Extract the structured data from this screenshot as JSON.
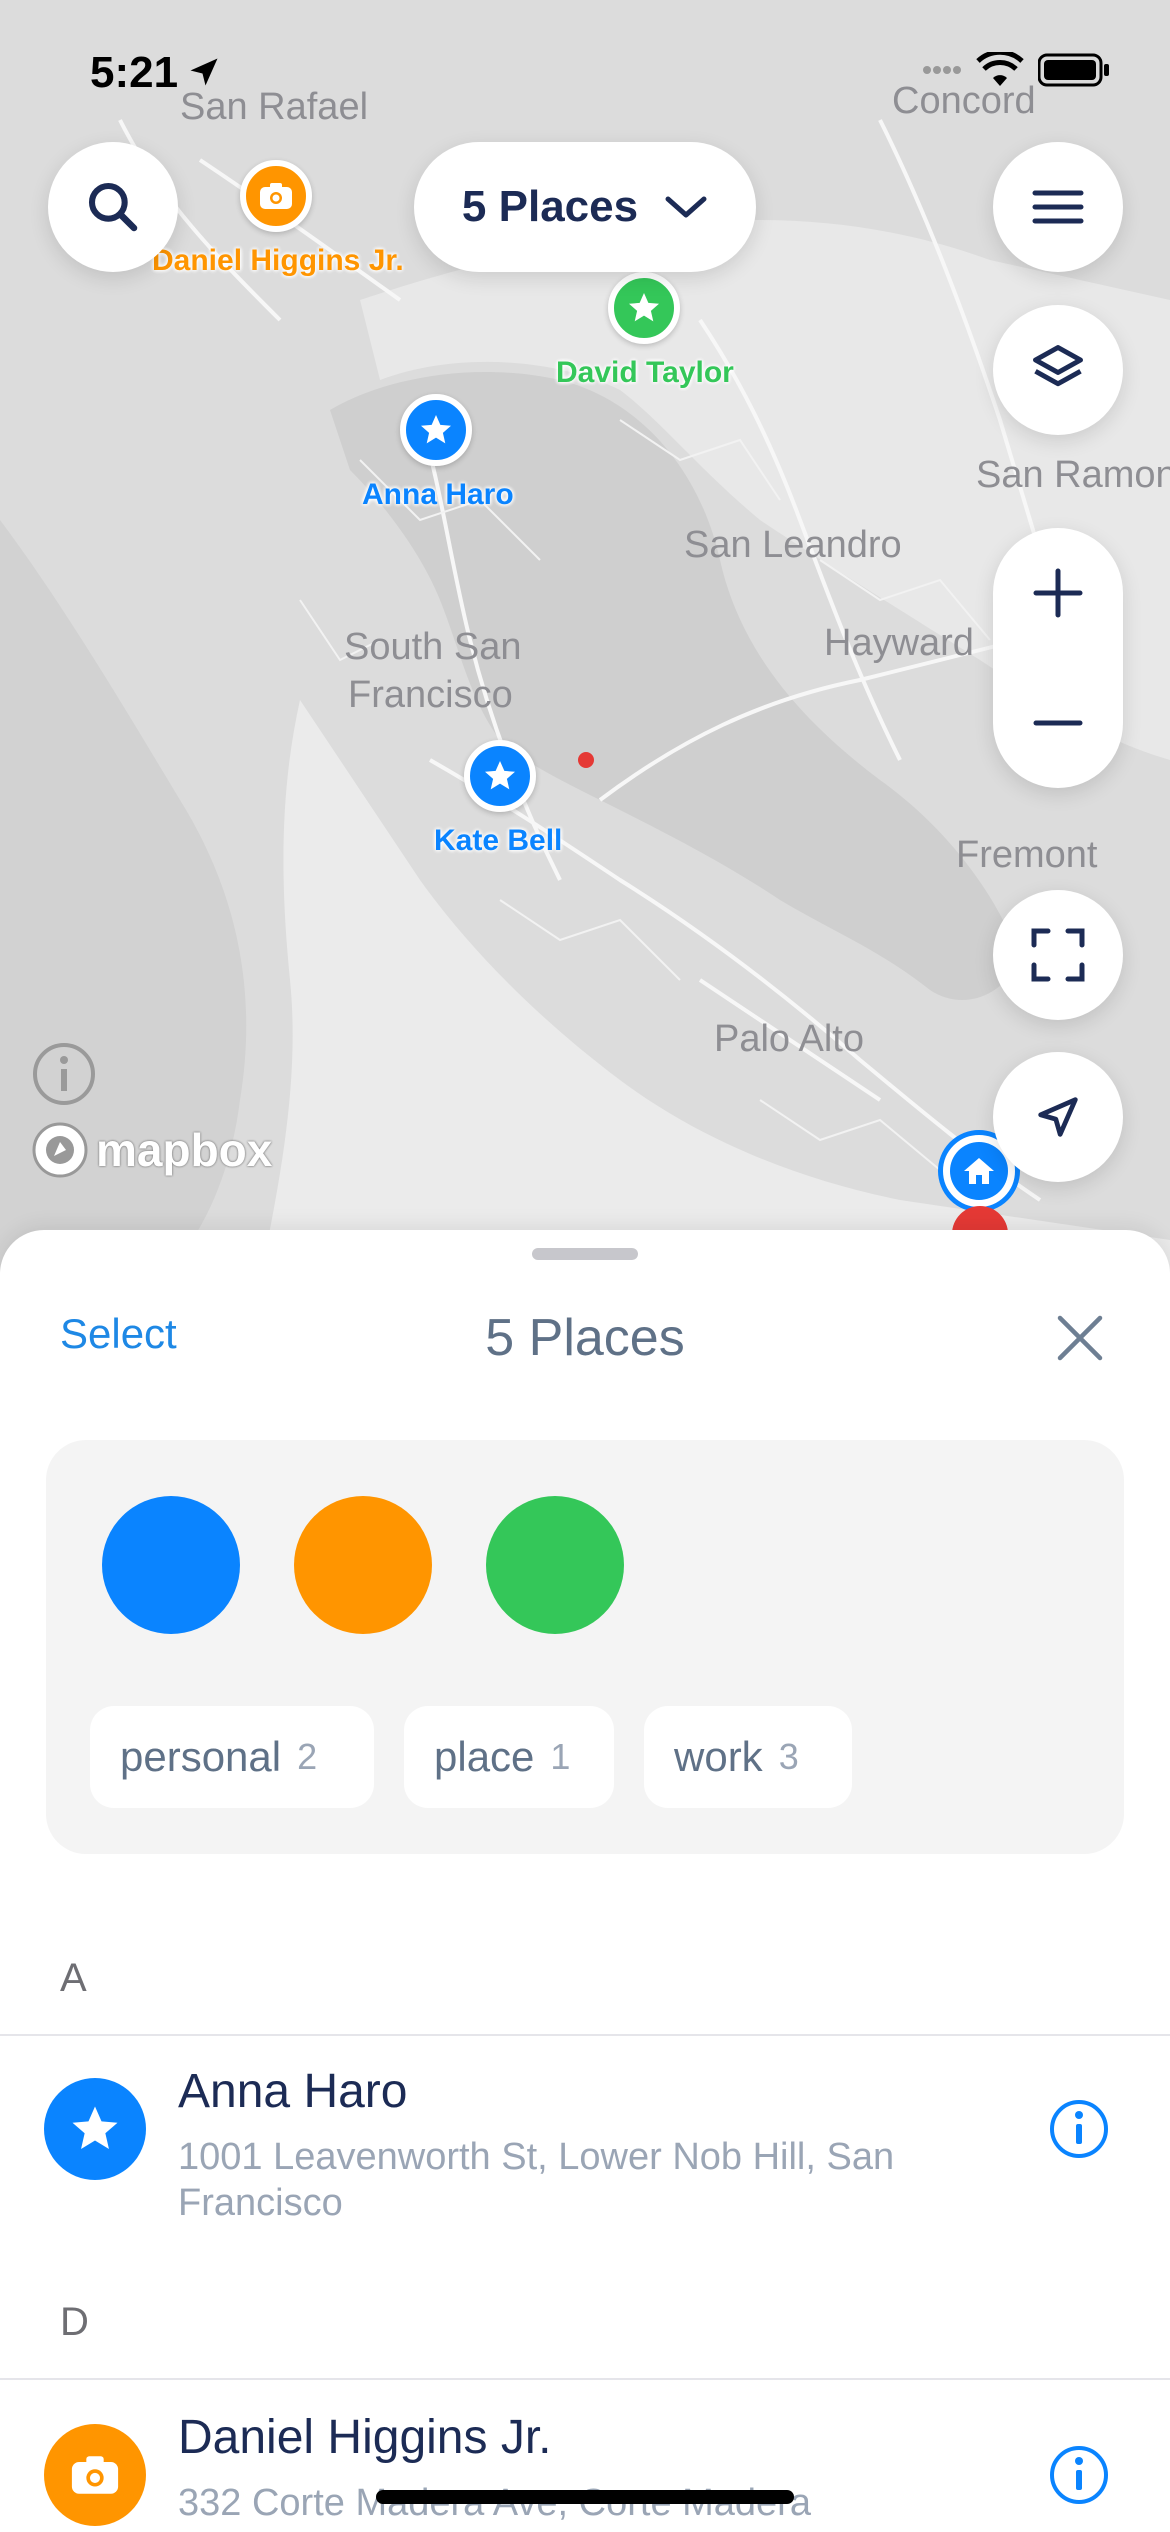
{
  "status_bar": {
    "time": "5:21"
  },
  "map": {
    "cities": [
      "San Rafael",
      "Concord",
      "San Ramon",
      "San Leandro",
      "Hayward",
      "South San",
      "Francisco",
      "Fremont",
      "Palo Alto"
    ],
    "places_button_label": "5 Places",
    "attribution": "mapbox",
    "markers": [
      {
        "name": "Daniel Higgins Jr.",
        "type": "camera",
        "color": "#ff9500"
      },
      {
        "name": "David Taylor",
        "type": "star",
        "color": "#34c759"
      },
      {
        "name": "Anna Haro",
        "type": "star",
        "color": "#0a84ff"
      },
      {
        "name": "Kate Bell",
        "type": "star",
        "color": "#0a84ff"
      }
    ]
  },
  "sheet": {
    "select_label": "Select",
    "title": "5 Places",
    "colors": [
      "#0a84ff",
      "#ff9500",
      "#34c759"
    ],
    "tags": [
      {
        "name": "personal",
        "count": "2"
      },
      {
        "name": "place",
        "count": "1"
      },
      {
        "name": "work",
        "count": "3"
      }
    ],
    "sections": [
      {
        "header": "A",
        "items": [
          {
            "title": "Anna Haro",
            "subtitle": "1001 Leavenworth St, Lower Nob Hill, San Francisco",
            "icon": "star-icon",
            "color": "#0a84ff"
          }
        ]
      },
      {
        "header": "D",
        "items": [
          {
            "title": "Daniel Higgins Jr.",
            "subtitle": "332 Corte Madera Ave, Corte Madera",
            "icon": "camera-icon",
            "color": "#ff9500"
          }
        ]
      }
    ]
  }
}
